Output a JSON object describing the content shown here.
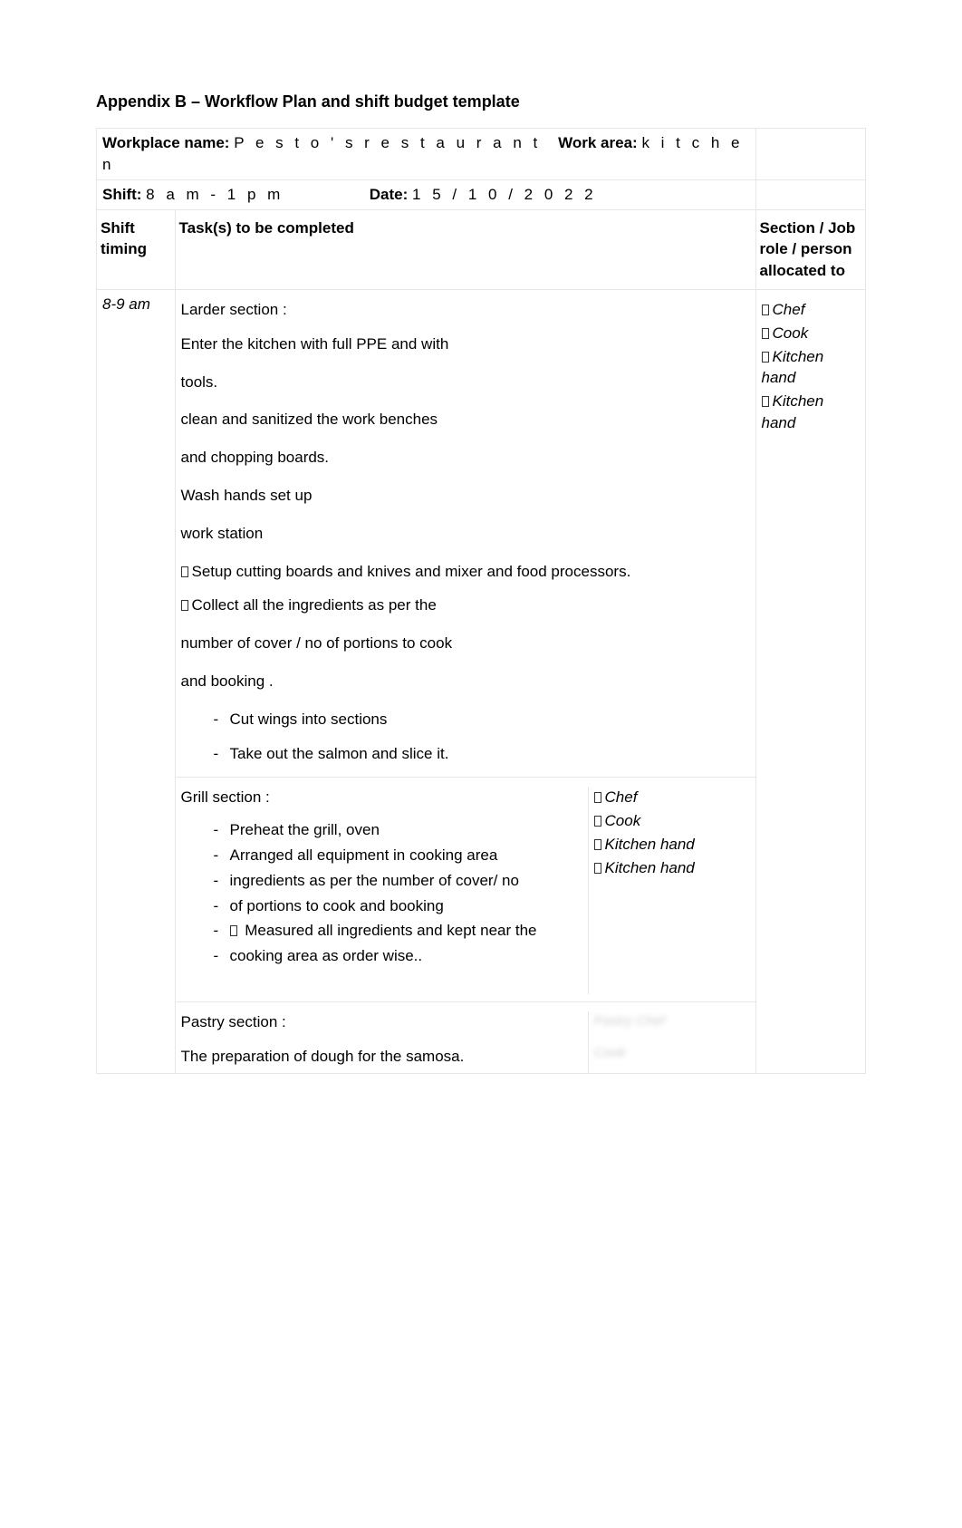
{
  "title": "Appendix B – Workflow Plan and shift budget template",
  "labels": {
    "workplace_name": "Workplace name:",
    "work_area": "Work area:",
    "shift": "Shift:",
    "date": "Date:"
  },
  "values": {
    "workplace_name": "P e s t o ' s   r e s t a u r a n t",
    "work_area": "k i t c h e n",
    "shift": "8 a m - 1   p m",
    "date": "1 5 / 1 0 / 2 0 2 2"
  },
  "columns": {
    "c1": "Shift timing",
    "c2": "Task(s) to be completed",
    "c3": "Section / Job role / person allocated to"
  },
  "timing": "8-9 am",
  "larder": {
    "heading": "Larder section :",
    "p1": "Enter the kitchen with full PPE and with",
    "p2": "tools.",
    "p3": "clean and sanitized the work benches",
    "p4": "and chopping boards.",
    "p5": "Wash hands set up",
    "p6": "work station",
    "b1": "Setup cutting boards and knives and mixer and food processors.",
    "b2": "Collect all the ingredients as per the",
    "p7": "number of cover / no of portions to cook",
    "p8": "and booking .",
    "li1": "Cut wings into sections",
    "li2": "Take out the salmon and slice it."
  },
  "roles": {
    "r1": "Chef",
    "r2": "Cook",
    "r3": "Kitchen hand",
    "r4": "Kitchen hand"
  },
  "grill": {
    "heading": "Grill section :",
    "li1": "Preheat the grill, oven",
    "li2": "Arranged all equipment in cooking area",
    "li3": "ingredients as per the number of cover/ no",
    "li4": "of portions to cook and booking",
    "li5": " Measured all ingredients and kept near the",
    "li6": "cooking area as order wise.."
  },
  "pastry": {
    "heading": "Pastry section :",
    "p1": "The preparation of dough for the samosa."
  },
  "blur": {
    "r1": "Pastry Chef",
    "r2": "Cook"
  }
}
